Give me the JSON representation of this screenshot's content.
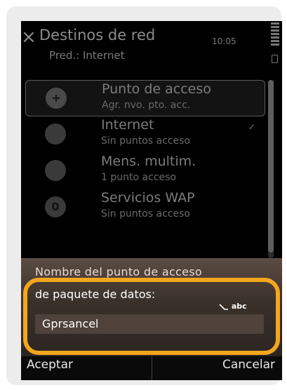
{
  "header": {
    "title": "Destinos de red",
    "subtitle": "Pred.: Internet",
    "time": "10:05"
  },
  "list": {
    "items": [
      {
        "name": "Punto de acceso",
        "detail": "Agr. nvo. pto. acc.",
        "icon": "globe-add-icon",
        "glyph": "+"
      },
      {
        "name": "Internet",
        "detail": "Sin puntos acceso",
        "icon": "globe-icon",
        "glyph": "",
        "check": "✓"
      },
      {
        "name": "Mens. multim.",
        "detail": "1 punto acceso",
        "icon": "mms-icon",
        "glyph": ""
      },
      {
        "name": "Servicios WAP",
        "detail": "Sin puntos acceso",
        "icon": "wap-icon",
        "glyph": "0"
      }
    ]
  },
  "dialog": {
    "label_line1": "Nombre del punto de acceso",
    "label_line2": "de paquete de datos:",
    "input_mode": "abc",
    "value": "Gprsancel"
  },
  "softkeys": {
    "left": "Aceptar",
    "right": "Cancelar"
  },
  "colors": {
    "highlight": "#f3a61d",
    "dialog": "#3a302a"
  }
}
